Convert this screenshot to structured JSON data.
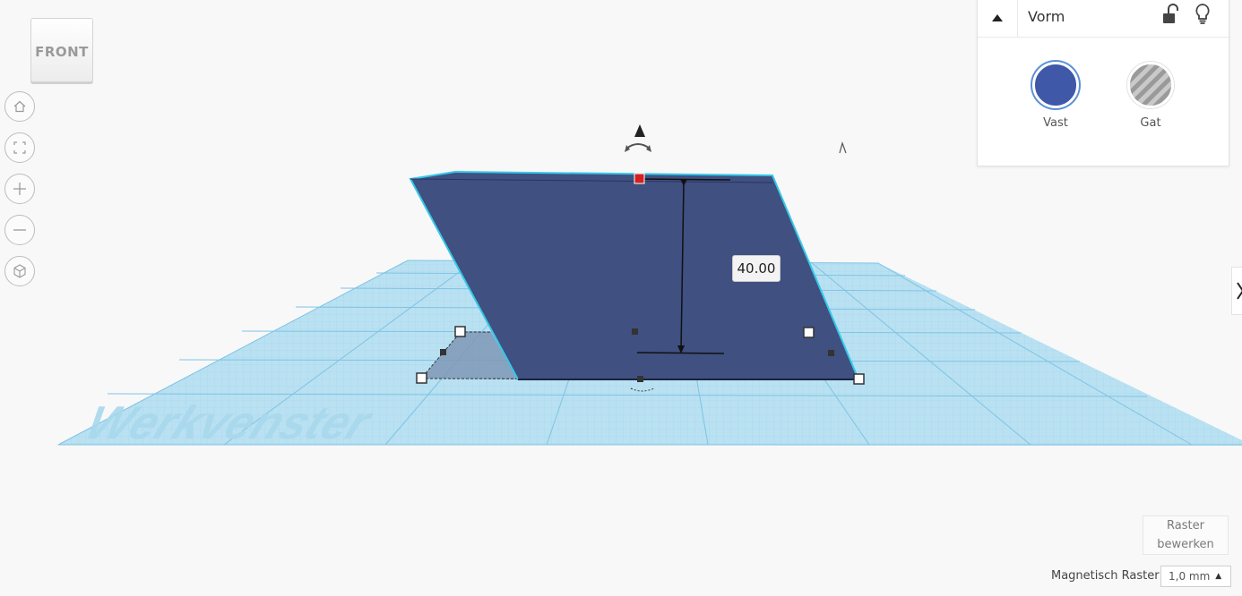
{
  "viewcube": {
    "face_label": "FRONT"
  },
  "nav": {
    "home_icon": "home-icon",
    "fit_icon": "fit-view-icon",
    "zoom_in_icon": "plus-icon",
    "zoom_out_icon": "minus-icon",
    "ortho_icon": "perspective-cube-icon"
  },
  "workplane": {
    "watermark": "Werkvenster"
  },
  "dimension": {
    "height_value": "40.00"
  },
  "shape_panel": {
    "title": "Vorm",
    "solid_label": "Vast",
    "hole_label": "Gat",
    "solid_color": "#3f58a8"
  },
  "grid": {
    "edit_label_line1": "Raster",
    "edit_label_line2": "bewerken",
    "snap_label": "Magnetisch Raster",
    "snap_value": "1,0 mm"
  }
}
